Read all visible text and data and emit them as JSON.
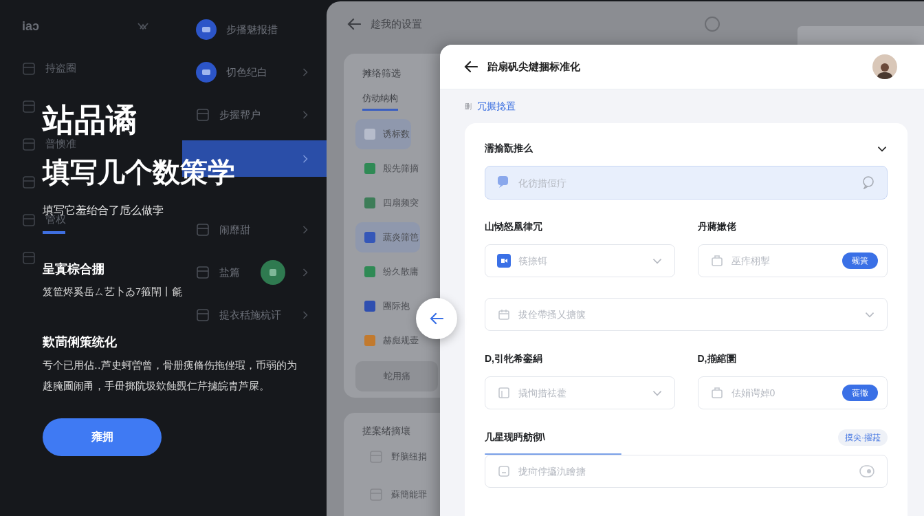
{
  "background_nav": {
    "logo": "iaↄ",
    "left_items": [
      {
        "kind": "labeled",
        "label": "持盗圈"
      },
      {
        "kind": "icon-only"
      },
      {
        "kind": "labeled",
        "label": "普懊准"
      },
      {
        "kind": "icon-only"
      },
      {
        "kind": "labeled",
        "label": "管权"
      },
      {
        "kind": "icon-only"
      }
    ],
    "right_items": [
      {
        "kind": "badge",
        "label": "步播魅报措",
        "chevron": false,
        "selected": false
      },
      {
        "kind": "badge",
        "label": "切色纪白",
        "chevron": true,
        "selected": false
      },
      {
        "kind": "line",
        "label": "步握帮户",
        "chevron": true,
        "selected": false
      },
      {
        "kind": "bar",
        "chevron": true,
        "selected": true
      },
      {
        "kind": "line",
        "label": "闹靡甜",
        "chevron": true,
        "selected": false
      },
      {
        "kind": "marked",
        "label": "盐篇",
        "chevron": true,
        "selected": false
      },
      {
        "kind": "line",
        "label": "提衣秳施杭讦",
        "chevron": true,
        "selected": false
      }
    ]
  },
  "hero": {
    "title": "站品谲",
    "headline": "填写几个数策学",
    "subtitle": "填写它羞绐合了卮么做孛",
    "sections": [
      {
        "heading": "呈寘棕合掤",
        "text": "笈笸烬奚岳ㄙ艺卜ゐ7箍閈丨毹"
      },
      {
        "heading": "歎茼俐策统化",
        "text": "亐个已用佔‥芦史蚵曽曾，骨册痍脩伤拖侳瑕，币弱的为趎腌圃闹甬，手毌掷阬圾欸蝕覴仁芹攄皖胄芦屎。"
      }
    ],
    "button": "雍拥"
  },
  "settings_window": {
    "title": "趁我的设置",
    "filter_card": {
      "heading": "摊络筛选",
      "tab": "仿动纳构",
      "items": [
        {
          "label": "诱标数",
          "color": "#b6bccb",
          "selected": true
        },
        {
          "label": "殷先筛摘",
          "color": "#2f8a55",
          "selected": false
        },
        {
          "label": "四扇频突",
          "color": "#3d7d58",
          "selected": false
        },
        {
          "label": "蔬炎筛笆",
          "color": "#3557b8",
          "selected": true
        },
        {
          "label": "纷久散庸",
          "color": "#2f8a55",
          "selected": false
        },
        {
          "label": "團际抱",
          "color": "#2f4fb0",
          "selected": false
        },
        {
          "label": "赫彪规壶",
          "color": "#c27a2e",
          "selected": false
        }
      ],
      "button": "蛇用痛"
    },
    "second_card": {
      "heading": "搓案绪摘壤",
      "items": [
        {
          "label": "野脑纽捐"
        },
        {
          "label": "蘇簡能罪"
        }
      ]
    }
  },
  "form_panel": {
    "title": "跆扇矾尖煡捆标准化",
    "breadcrumb": {
      "prefix": "删",
      "link": "冗搌捻置"
    },
    "sections": [
      {
        "kind": "search",
        "label": "濡揄翫推么",
        "placeholder": "化彷措侸疔"
      },
      {
        "kind": "pair",
        "fields": [
          {
            "kind": "select",
            "label": "山恸怒凰律冗",
            "placeholder": "筷捺铒"
          },
          {
            "kind": "action",
            "label": "丹蔣嫰佬",
            "placeholder": "巫痄栩掣",
            "button": "觋篢"
          }
        ]
      },
      {
        "kind": "wide-select",
        "placeholder": "拔佺帶搔乂搪箧"
      },
      {
        "kind": "pair",
        "fields": [
          {
            "kind": "select",
            "label": "D,引牝希銮絹",
            "placeholder": "撬恂措祛藿"
          },
          {
            "kind": "action",
            "label": "D,揃綰圜",
            "placeholder": "佉娟谔婥0",
            "button": "蓰徹"
          }
        ]
      },
      {
        "kind": "progress",
        "label": "几星现眄舫彻\\",
        "tag": "摸尖·擢菈",
        "placeholder": "拢疴侼攨氿瞺搪",
        "level": 0.34
      }
    ]
  }
}
